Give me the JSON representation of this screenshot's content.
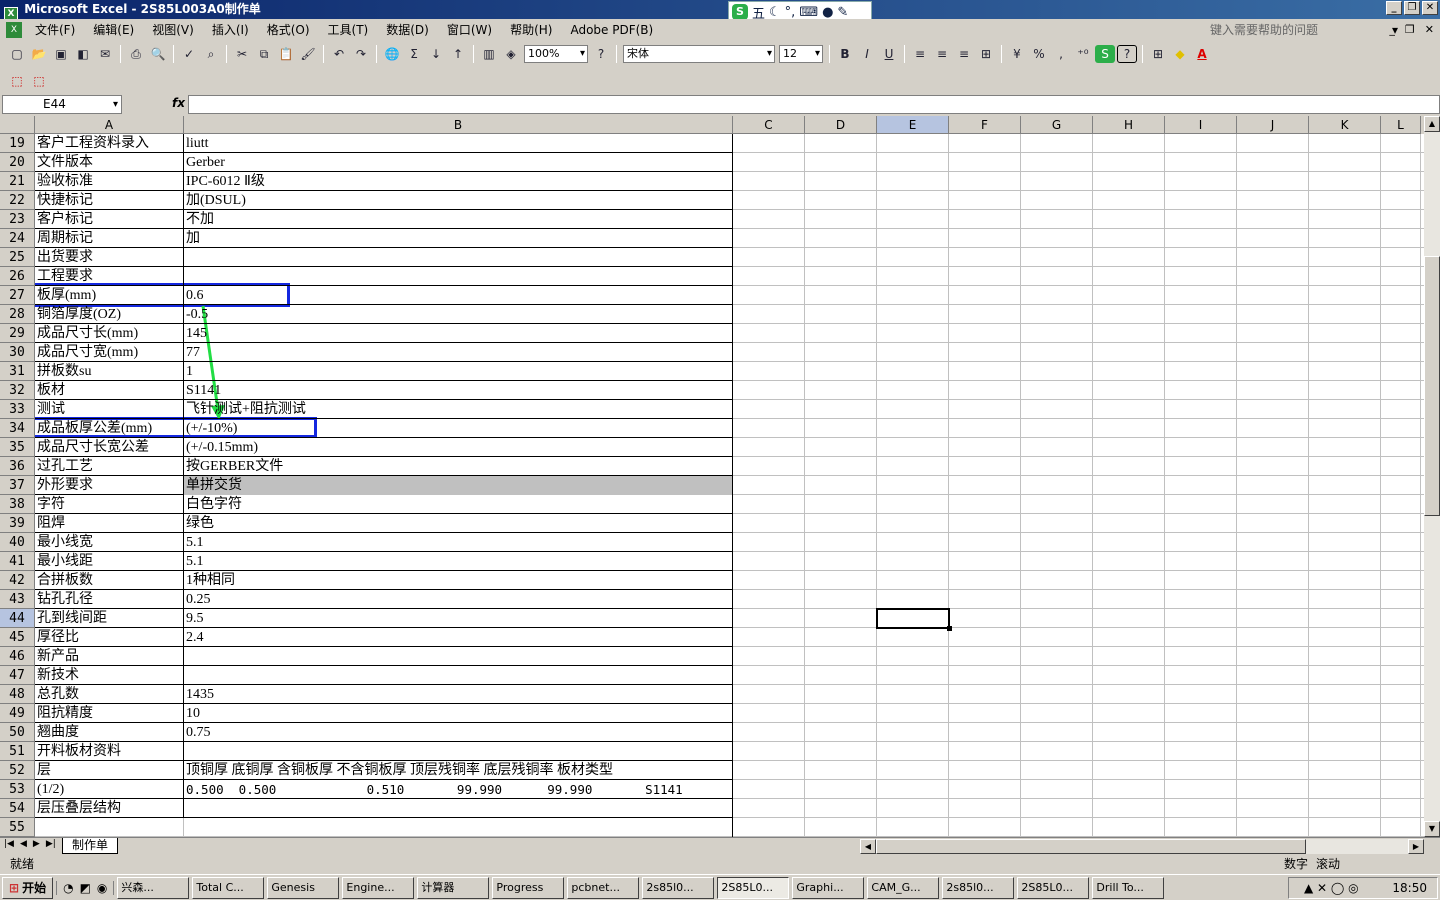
{
  "window": {
    "title": "Microsoft Excel - 2S85L003A0制作单"
  },
  "ime": {
    "mode": "五",
    "icons": [
      "moon-icon",
      "punct-icon",
      "keyboard-icon",
      "user-icon",
      "wrench-icon"
    ]
  },
  "menu": [
    "文件(F)",
    "编辑(E)",
    "视图(V)",
    "插入(I)",
    "格式(O)",
    "工具(T)",
    "数据(D)",
    "窗口(W)",
    "帮助(H)",
    "Adobe PDF(B)"
  ],
  "help_placeholder": "键入需要帮助的问题",
  "toolbar": {
    "zoom": "100%",
    "font": "宋体",
    "size": "12",
    "bold": "B",
    "italic": "I",
    "underline": "U",
    "percent": "%",
    "comma": ","
  },
  "formula": {
    "cell_ref": "E44",
    "fx": "fx",
    "value": ""
  },
  "columns": [
    "A",
    "B",
    "C",
    "D",
    "E",
    "F",
    "G",
    "H",
    "I",
    "J",
    "K",
    "L"
  ],
  "selected_col": "E",
  "selected_row": "44",
  "rows": [
    {
      "n": "19",
      "a": "客户工程资料录入",
      "b": "liutt"
    },
    {
      "n": "20",
      "a": "文件版本",
      "b": "Gerber"
    },
    {
      "n": "21",
      "a": "验收标准",
      "b": "IPC-6012 Ⅱ级"
    },
    {
      "n": "22",
      "a": "快捷标记",
      "b": "加(DSUL)"
    },
    {
      "n": "23",
      "a": "客户标记",
      "b": "不加"
    },
    {
      "n": "24",
      "a": "周期标记",
      "b": "加"
    },
    {
      "n": "25",
      "a": "出货要求",
      "b": ""
    },
    {
      "n": "26",
      "a": "工程要求",
      "b": ""
    },
    {
      "n": "27",
      "a": "板厚(mm)",
      "b": "0.6"
    },
    {
      "n": "28",
      "a": "铜箔厚度(OZ)",
      "b": "-0.5"
    },
    {
      "n": "29",
      "a": "成品尺寸长(mm)",
      "b": "145"
    },
    {
      "n": "30",
      "a": "成品尺寸宽(mm)",
      "b": "77"
    },
    {
      "n": "31",
      "a": "拼板数su",
      "b": "1"
    },
    {
      "n": "32",
      "a": "板材",
      "b": "S1141"
    },
    {
      "n": "33",
      "a": "测试",
      "b": "飞针测试+阻抗测试"
    },
    {
      "n": "34",
      "a": "成品板厚公差(mm)",
      "b": "(+/-10%)"
    },
    {
      "n": "35",
      "a": "成品尺寸长宽公差",
      "b": "(+/-0.15mm)"
    },
    {
      "n": "36",
      "a": "过孔工艺",
      "b": "按GERBER文件"
    },
    {
      "n": "37",
      "a": "外形要求",
      "b": "单拼交货"
    },
    {
      "n": "38",
      "a": "字符",
      "b": "白色字符"
    },
    {
      "n": "39",
      "a": "阻焊",
      "b": "绿色"
    },
    {
      "n": "40",
      "a": "最小线宽",
      "b": "5.1"
    },
    {
      "n": "41",
      "a": "最小线距",
      "b": "5.1"
    },
    {
      "n": "42",
      "a": "合拼板数",
      "b": "1种相同"
    },
    {
      "n": "43",
      "a": "钻孔孔径",
      "b": "0.25"
    },
    {
      "n": "44",
      "a": "孔到线间距",
      "b": "9.5"
    },
    {
      "n": "45",
      "a": "厚径比",
      "b": "2.4"
    },
    {
      "n": "46",
      "a": "新产品",
      "b": ""
    },
    {
      "n": "47",
      "a": "新技术",
      "b": ""
    },
    {
      "n": "48",
      "a": "总孔数",
      "b": "1435"
    },
    {
      "n": "49",
      "a": "阻抗精度",
      "b": "10"
    },
    {
      "n": "50",
      "a": "翘曲度",
      "b": "0.75"
    },
    {
      "n": "51",
      "a": "开料板材资料",
      "b": ""
    },
    {
      "n": "52",
      "a": "层",
      "b": "顶铜厚 底铜厚 含铜板厚 不含铜板厚 顶层残铜率 底层残铜率 板材类型"
    },
    {
      "n": "53",
      "a": "(1/2)",
      "b": "0.500  0.500            0.510       99.990      99.990       S1141"
    },
    {
      "n": "54",
      "a": "层压叠层结构",
      "b": ""
    },
    {
      "n": "55",
      "a": "",
      "b": ""
    }
  ],
  "sheet_tab": "制作单",
  "status": {
    "left": "就绪",
    "num": "数字",
    "scroll": "滚动"
  },
  "taskbar": {
    "start": "开始",
    "tasks": [
      "兴森...",
      "Total C...",
      "Genesis",
      "Engine...",
      "计算器",
      "Progress",
      "pcbnet...",
      "2s85l0...",
      "2S85L0...",
      "Graphi...",
      "CAM_G...",
      "2s85l0...",
      "2S85L0...",
      "Drill To..."
    ],
    "clock": "18:50"
  },
  "colors": {
    "annotation_box": "#1428e0",
    "annotation_arrow": "#22dd44",
    "selection": "#b6c4e0"
  }
}
